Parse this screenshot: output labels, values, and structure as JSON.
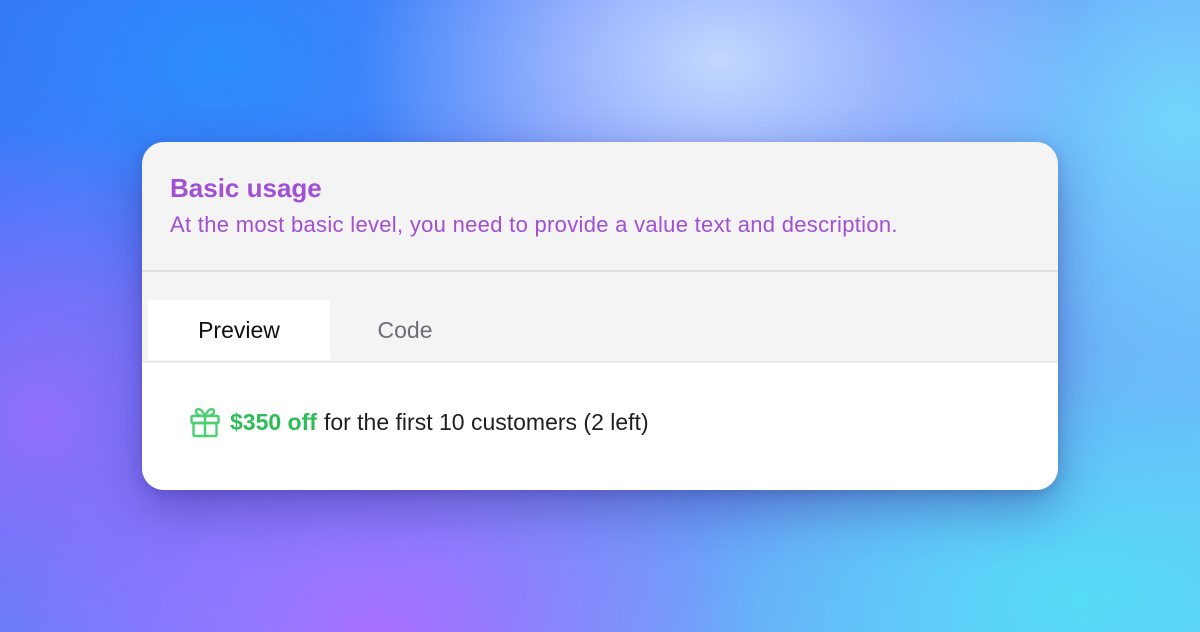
{
  "card": {
    "title": "Basic usage",
    "description": "At the most basic level, you need to provide a value text and description."
  },
  "tabs": [
    {
      "label": "Preview",
      "active": true
    },
    {
      "label": "Code",
      "active": false
    }
  ],
  "preview": {
    "icon": "gift-icon",
    "value_text": "$350 off",
    "description_text": "for the first 10 customers (2 left)"
  },
  "colors": {
    "title": "#a24fd6",
    "value": "#2dbd55",
    "icon": "#4ccf72"
  }
}
